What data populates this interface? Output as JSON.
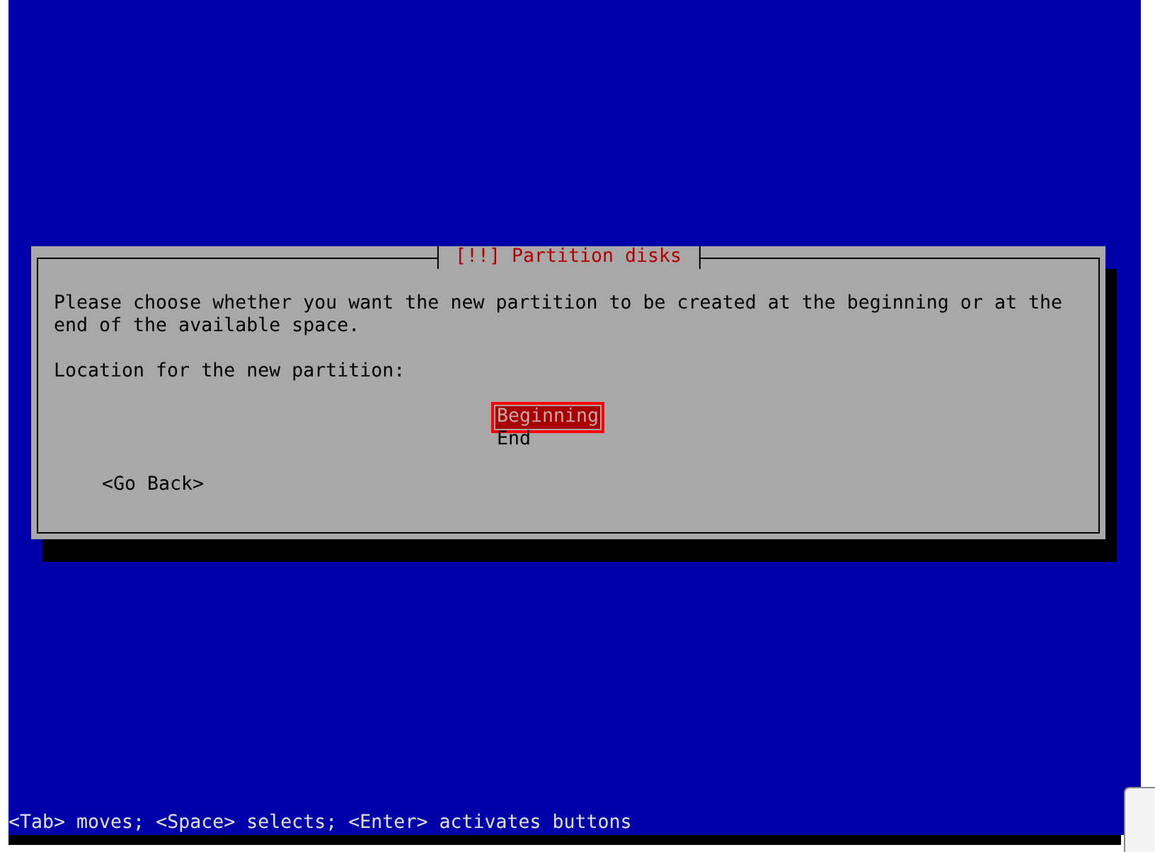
{
  "dialog": {
    "title": "[!!] Partition disks",
    "message": "Please choose whether you want the new partition to be created at the beginning or at the end of the available space.",
    "prompt": "Location for the new partition:",
    "options": [
      {
        "label": "Beginning",
        "selected": true
      },
      {
        "label": "End",
        "selected": false
      }
    ],
    "back_button": "<Go Back>"
  },
  "status_bar": "<Tab> moves; <Space> selects; <Enter> activates buttons"
}
